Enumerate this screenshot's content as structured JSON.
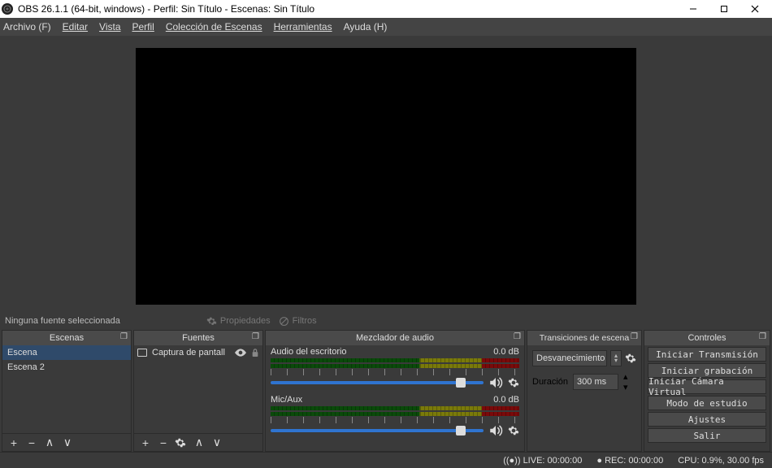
{
  "window": {
    "title": "OBS 26.1.1 (64-bit, windows) - Perfil: Sin Título - Escenas: Sin Título"
  },
  "menu": {
    "archivo": "Archivo (F)",
    "editar": "Editar",
    "vista": "Vista",
    "perfil": "Perfil",
    "coleccion": "Colección de Escenas",
    "herramientas": "Herramientas",
    "ayuda": "Ayuda (H)"
  },
  "source_bar": {
    "no_source": "Ninguna fuente seleccionada",
    "props": "Propiedades",
    "filters": "Filtros"
  },
  "docks": {
    "scenes": {
      "title": "Escenas",
      "items": [
        "Escena",
        "Escena 2"
      ],
      "selected": 0
    },
    "sources": {
      "title": "Fuentes",
      "items": [
        {
          "label": "Captura de pantall"
        }
      ]
    },
    "mixer": {
      "title": "Mezclador de audio",
      "channels": [
        {
          "name": "Audio del escritorio",
          "db": "0.0 dB"
        },
        {
          "name": "Mic/Aux",
          "db": "0.0 dB"
        }
      ]
    },
    "transitions": {
      "title": "Transiciones de escena",
      "selected": "Desvanecimiento",
      "duration_label": "Duración",
      "duration_value": "300 ms"
    },
    "controls": {
      "title": "Controles",
      "buttons": {
        "stream": "Iniciar Transmisión",
        "record": "Iniciar grabación",
        "vcam": "Iniciar Cámara Virtual",
        "studio": "Modo de estudio",
        "settings": "Ajustes",
        "exit": "Salir"
      }
    }
  },
  "status": {
    "live": "LIVE: 00:00:00",
    "rec": "REC: 00:00:00",
    "cpu": "CPU: 0.9%, 30.00 fps"
  }
}
